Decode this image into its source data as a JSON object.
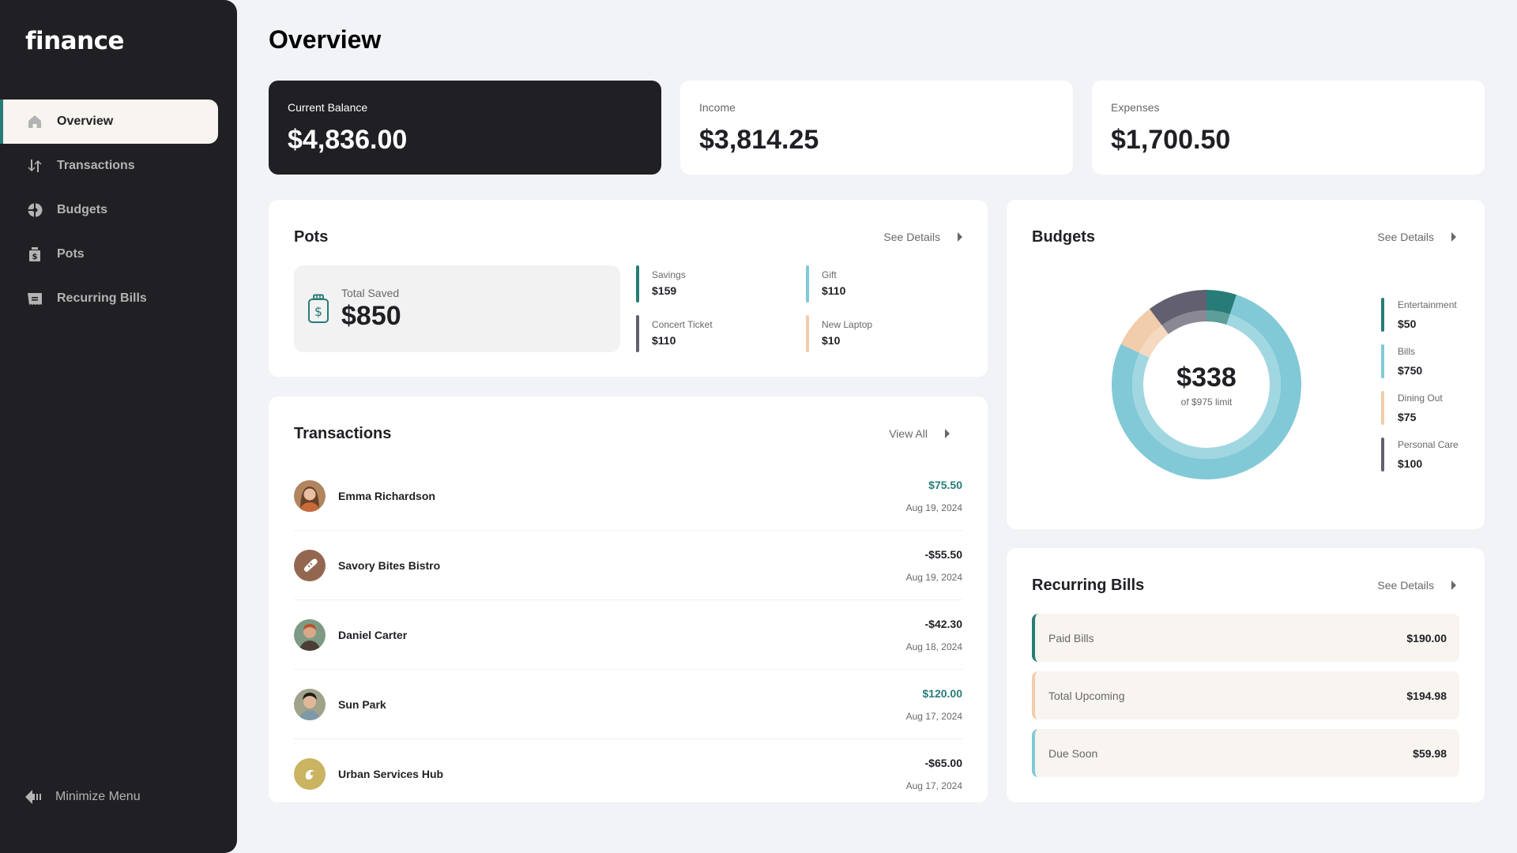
{
  "app": {
    "logo": "finance"
  },
  "sidebar": {
    "items": [
      {
        "label": "Overview",
        "icon": "home-icon",
        "active": true
      },
      {
        "label": "Transactions",
        "icon": "arrows-up-down-icon",
        "active": false
      },
      {
        "label": "Budgets",
        "icon": "pie-chart-icon",
        "active": false
      },
      {
        "label": "Pots",
        "icon": "jar-icon",
        "active": false
      },
      {
        "label": "Recurring Bills",
        "icon": "receipt-icon",
        "active": false
      }
    ],
    "minimize_label": "Minimize Menu"
  },
  "page": {
    "title": "Overview"
  },
  "summary": {
    "balance": {
      "label": "Current Balance",
      "value": "$4,836.00"
    },
    "income": {
      "label": "Income",
      "value": "$3,814.25"
    },
    "expenses": {
      "label": "Expenses",
      "value": "$1,700.50"
    }
  },
  "pots": {
    "title": "Pots",
    "link": "See Details",
    "total_label": "Total Saved",
    "total_value": "$850",
    "items": [
      {
        "name": "Savings",
        "amount": "$159",
        "color": "#277c78"
      },
      {
        "name": "Gift",
        "amount": "$110",
        "color": "#82c9d7"
      },
      {
        "name": "Concert Ticket",
        "amount": "$110",
        "color": "#626070"
      },
      {
        "name": "New Laptop",
        "amount": "$10",
        "color": "#f2cdac"
      }
    ]
  },
  "transactions": {
    "title": "Transactions",
    "link": "View All",
    "items": [
      {
        "name": "Emma Richardson",
        "amount": "$75.50",
        "positive": true,
        "date": "Aug 19, 2024",
        "avatar": "photo",
        "avatar_color": "#8a5a3c"
      },
      {
        "name": "Savory Bites Bistro",
        "amount": "-$55.50",
        "positive": false,
        "date": "Aug 19, 2024",
        "avatar": "bread-icon",
        "avatar_color": "#93674f"
      },
      {
        "name": "Daniel Carter",
        "amount": "-$42.30",
        "positive": false,
        "date": "Aug 18, 2024",
        "avatar": "photo",
        "avatar_color": "#6f8a6e"
      },
      {
        "name": "Sun Park",
        "amount": "$120.00",
        "positive": true,
        "date": "Aug 17, 2024",
        "avatar": "photo",
        "avatar_color": "#7d9aa6"
      },
      {
        "name": "Urban Services Hub",
        "amount": "-$65.00",
        "positive": false,
        "date": "Aug 17, 2024",
        "avatar": "service-icon",
        "avatar_color": "#cab361"
      }
    ]
  },
  "budgets": {
    "title": "Budgets",
    "link": "See Details",
    "spent": "$338",
    "limit_text": "of $975 limit"
  },
  "recurring": {
    "title": "Recurring Bills",
    "link": "See Details",
    "items": [
      {
        "label": "Paid Bills",
        "amount": "$190.00",
        "color": "#277c78"
      },
      {
        "label": "Total Upcoming",
        "amount": "$194.98",
        "color": "#f2cdac"
      },
      {
        "label": "Due Soon",
        "amount": "$59.98",
        "color": "#82c9d7"
      }
    ]
  },
  "chart_data": {
    "type": "pie",
    "title": "Budgets",
    "categories": [
      "Entertainment",
      "Bills",
      "Dining Out",
      "Personal Care"
    ],
    "values": [
      50,
      750,
      75,
      100
    ],
    "labels": [
      "$50",
      "$750",
      "$75",
      "$100"
    ],
    "colors": [
      "#277c78",
      "#82c9d7",
      "#f2cdac",
      "#626070"
    ],
    "center_value": "$338",
    "center_caption": "of $975 limit",
    "legend": "right"
  }
}
